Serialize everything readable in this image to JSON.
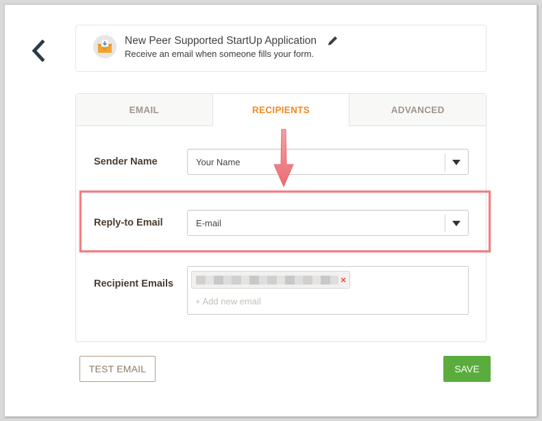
{
  "header": {
    "title": "New Peer Supported StartUp Application",
    "subtitle": "Receive an email when someone fills your form."
  },
  "tabs": [
    {
      "label": "EMAIL",
      "active": false
    },
    {
      "label": "RECIPIENTS",
      "active": true
    },
    {
      "label": "ADVANCED",
      "active": false
    }
  ],
  "sender_name": {
    "label": "Sender Name",
    "value": "Your Name"
  },
  "reply_to": {
    "label": "Reply-to Email",
    "value": "E-mail"
  },
  "recipients": {
    "label": "Recipient Emails",
    "remove_glyph": "×",
    "add_label": "+ Add new email"
  },
  "buttons": {
    "test_email": "TEST EMAIL",
    "save": "SAVE"
  },
  "colors": {
    "accent": "#ef8a1a",
    "save_green": "#5aad3d",
    "highlight_red": "#ef7f84",
    "label_brown": "#4b3b2e"
  },
  "icons": {
    "back": "chevron-left-icon",
    "email": "email-notification-icon",
    "edit": "pencil-icon",
    "dropdown": "caret-down-icon",
    "remove": "close-icon"
  }
}
